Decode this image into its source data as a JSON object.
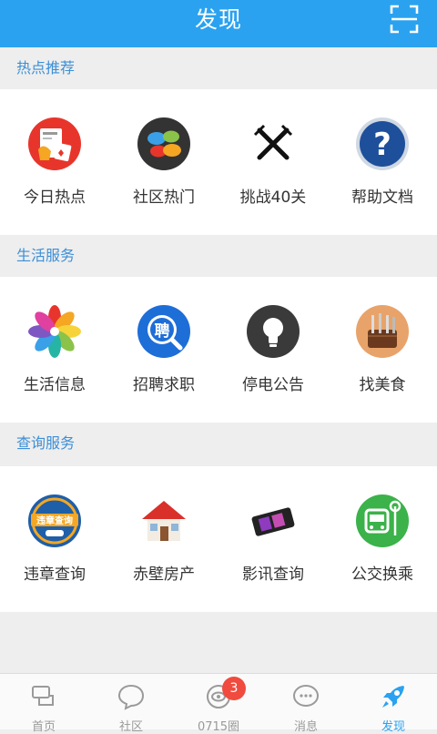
{
  "header": {
    "title": "发现"
  },
  "sections": [
    {
      "title": "热点推荐",
      "items": [
        {
          "label": "今日热点",
          "icon": "news-icon"
        },
        {
          "label": "社区热门",
          "icon": "chat-bubbles-icon"
        },
        {
          "label": "挑战40关",
          "icon": "crossed-swords-icon"
        },
        {
          "label": "帮助文档",
          "icon": "help-question-icon"
        }
      ]
    },
    {
      "title": "生活服务",
      "items": [
        {
          "label": "生活信息",
          "icon": "pinwheel-icon"
        },
        {
          "label": "招聘求职",
          "icon": "recruit-search-icon"
        },
        {
          "label": "停电公告",
          "icon": "light-bulb-icon"
        },
        {
          "label": "找美食",
          "icon": "chef-tools-icon"
        }
      ]
    },
    {
      "title": "查询服务",
      "items": [
        {
          "label": "违章查询",
          "icon": "traffic-violation-icon"
        },
        {
          "label": "赤壁房产",
          "icon": "house-icon"
        },
        {
          "label": "影讯查询",
          "icon": "film-reel-icon"
        },
        {
          "label": "公交换乘",
          "icon": "bus-icon"
        }
      ]
    }
  ],
  "tabs": [
    {
      "label": "首页",
      "icon": "home-chat-icon"
    },
    {
      "label": "社区",
      "icon": "speech-bubble-icon"
    },
    {
      "label": "0715圈",
      "icon": "circle-eye-icon",
      "badge": "3"
    },
    {
      "label": "消息",
      "icon": "message-dots-icon"
    },
    {
      "label": "发现",
      "icon": "rocket-icon",
      "active": true
    }
  ],
  "colors": {
    "brand": "#2aa2f0",
    "section_title": "#3d8fd6",
    "badge": "#f04b3e"
  }
}
